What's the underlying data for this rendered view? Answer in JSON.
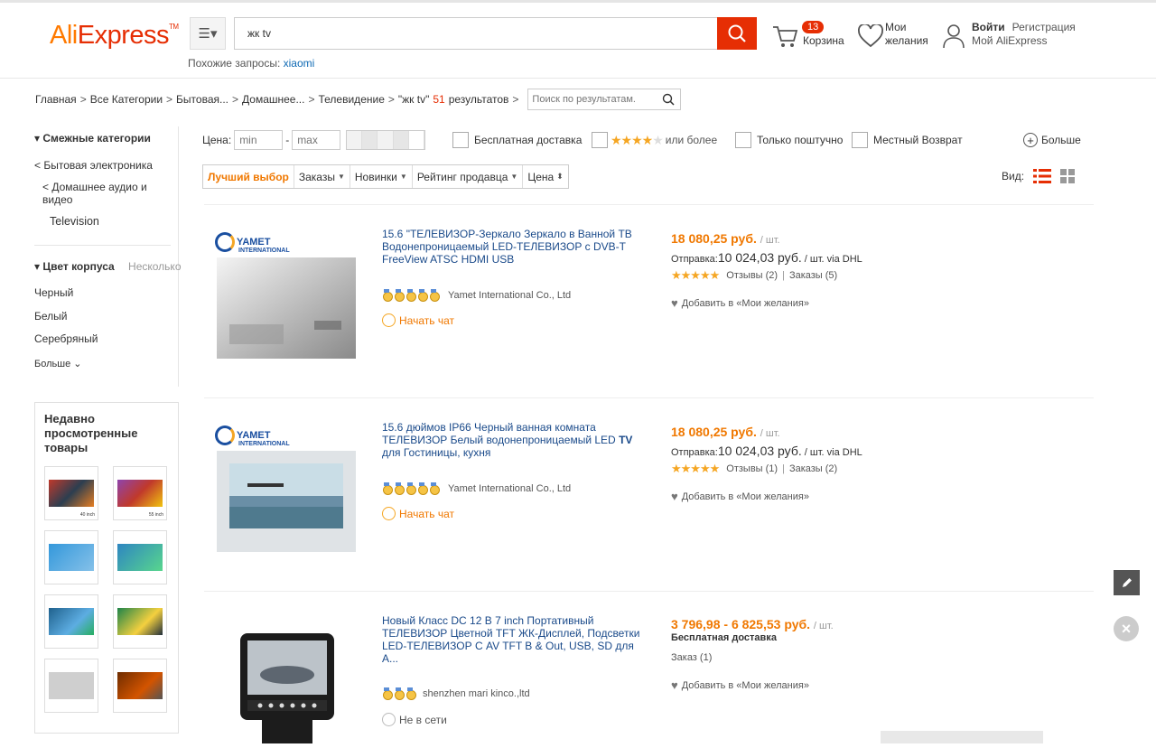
{
  "header": {
    "logo_part1": "Ali",
    "logo_part2": "Express",
    "logo_tm": "TM",
    "search_value": "жк tv",
    "similar_label": "Похожие запросы:",
    "similar_link": "xiaomi",
    "cart_count": "13",
    "cart_label": "Корзина",
    "wish_line1": "Мои",
    "wish_line2": "желания",
    "login": "Войти",
    "register": "Регистрация",
    "my_ali": "Мой AliExpress"
  },
  "breadcrumb": {
    "items": [
      "Главная",
      "Все Категории",
      "Бытовая...",
      "Домашнее...",
      "Телевидение",
      "\"жк tv\""
    ],
    "count": "51",
    "results_label": "результатов",
    "search_placeholder": "Поиск по результатам."
  },
  "sidebar": {
    "related_title": "Смежные категории",
    "cat1": "< Бытовая электроника",
    "cat2": "< Домашнее аудио и видео",
    "cat3": "Television",
    "color_title": "Цвет корпуса",
    "color_multi": "Несколько",
    "colors": [
      "Черный",
      "Белый",
      "Серебряный"
    ],
    "more": "Больше",
    "recent_title": "Недавно просмотренные товары",
    "thumb_labels": [
      "40 inch",
      "55 inch"
    ]
  },
  "filters": {
    "price_label": "Цена:",
    "min_placeholder": "min",
    "max_placeholder": "max",
    "free_shipping": "Бесплатная доставка",
    "rating_more": "или более",
    "single_piece": "Только поштучно",
    "local_return": "Местный Возврат",
    "more": "Больше"
  },
  "sort": {
    "best": "Лучший выбор",
    "orders": "Заказы",
    "new": "Новинки",
    "seller_rating": "Рейтинг продавца",
    "price": "Цена",
    "view_label": "Вид:"
  },
  "products": [
    {
      "brand": "YAMET",
      "brand_sub": "INTERNATIONAL",
      "title": "15.6 \"ТЕЛЕВИЗОР-Зеркало Зеркало в Ванной ТВ Водонепроницаемый LED-ТЕЛЕВИЗОР с DVB-T FreeView ATSC HDMI USB",
      "seller": "Yamet International Co., Ltd",
      "chat": "Начать чат",
      "price": "18 080,25 руб.",
      "unit": "/ шт.",
      "ship_label": "Отправка:",
      "ship_price": "10 024,03 руб.",
      "ship_unit": "/ шт. via DHL",
      "reviews": "Отзывы (2)",
      "orders": "Заказы (5)",
      "wish": "Добавить в «Мои желания»"
    },
    {
      "brand": "YAMET",
      "brand_sub": "INTERNATIONAL",
      "title": "15.6 дюймов IP66 Черный ванная комната ТЕЛЕВИЗОР Белый водонепроницаемый LED",
      "title_bold": "TV",
      "title_tail": "для Гостиницы, кухня",
      "seller": "Yamet International Co., Ltd",
      "chat": "Начать чат",
      "price": "18 080,25 руб.",
      "unit": "/ шт.",
      "ship_label": "Отправка:",
      "ship_price": "10 024,03 руб.",
      "ship_unit": "/ шт. via DHL",
      "reviews": "Отзывы (1)",
      "orders": "Заказы (2)",
      "wish": "Добавить в «Мои желания»"
    },
    {
      "title": "Новый Класс DC 12 В 7 inch Портативный ТЕЛЕВИЗОР Цветной TFT ЖК-Дисплей, Подсветки LED-ТЕЛЕВИЗОР С AV TFT В & Out, USB, SD для А...",
      "seller": "shenzhen mari kinco.,ltd",
      "chat": "Не в сети",
      "price": "3 796,98 - 6 825,53 руб.",
      "unit": "/ шт.",
      "free_ship": "Бесплатная доставка",
      "orders": "Заказ (1)",
      "wish": "Добавить в «Мои желания»"
    }
  ],
  "colors": {
    "accent": "#e62e04",
    "orange": "#f07800",
    "link": "#1a4a8a"
  }
}
